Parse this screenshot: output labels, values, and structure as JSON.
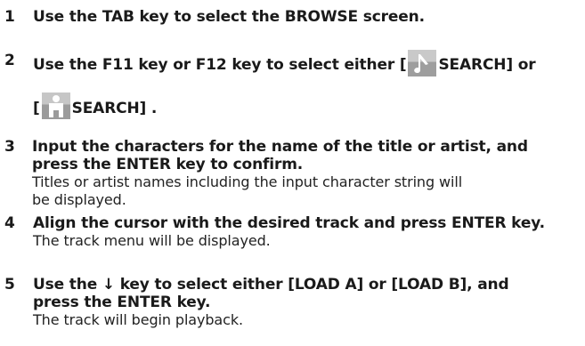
{
  "steps": [
    {
      "num": "1",
      "text": "Use the TAB key to select the BROWSE screen."
    },
    {
      "num": "2",
      "part1": "Use the F11 key or F12 key to select either  [",
      "part2": "SEARCH]  or",
      "part3": "[",
      "part4": "SEARCH] ."
    },
    {
      "num": "3",
      "line1": " Input the characters for the name of the title or artist, and",
      "line2": "press the ENTER key to confirm.",
      "desc1": "Titles or artist names including the input character string will",
      "desc2": "be displayed."
    },
    {
      "num": "4",
      "line1": "Align the cursor with the desired track and press ENTER key.",
      "desc1": "The track menu will be displayed."
    },
    {
      "num": "5",
      "line1": "Use the ↓ key to select either [LOAD A] or [LOAD B], and",
      "line2": "press the ENTER key.",
      "desc1": "The track will begin playback."
    }
  ],
  "icons": {
    "music": "music-note-icon",
    "artist": "artist-icon"
  }
}
